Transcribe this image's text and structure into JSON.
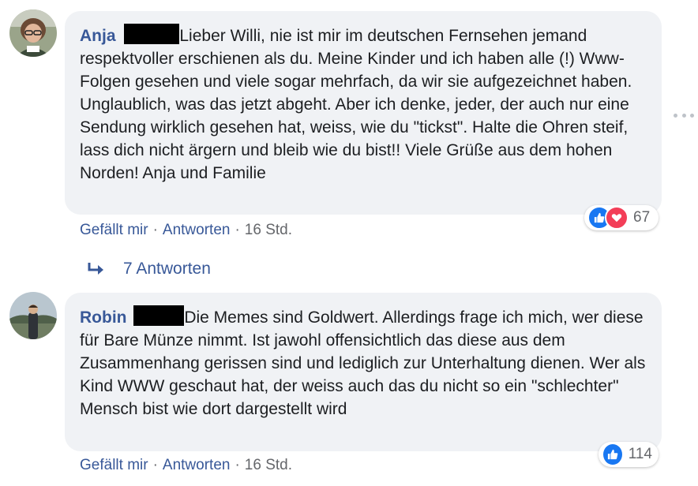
{
  "comments": [
    {
      "author": "Anja",
      "text": "Lieber Willi, nie ist mir im deutschen Fernsehen jemand respektvoller erschienen als du. Meine Kinder und ich haben alle (!) Www-Folgen gesehen und viele sogar mehrfach, da wir sie aufgezeichnet haben. Unglaublich, was das jetzt abgeht. Aber ich denke, jeder, der auch nur eine Sendung wirklich gesehen hat, weiss, wie du \"tickst\". Halte die Ohren steif, lass dich nicht ärgern und bleib wie du bist!! Viele Grüße aus dem hohen Norden! Anja und Familie",
      "like_label": "Gefällt mir",
      "reply_label": "Antworten",
      "time": "16 Std.",
      "reaction_count": "67",
      "reaction_icons": [
        "like-icon",
        "love-icon"
      ],
      "replies_label": "7 Antworten"
    },
    {
      "author": "Robin",
      "text": "Die Memes sind Goldwert. Allerdings frage ich mich, wer diese für Bare Münze nimmt. Ist jawohl offensichtlich das diese aus dem Zusammenhang gerissen sind und lediglich zur Unterhaltung dienen. Wer als Kind WWW geschaut hat, der weiss auch das du nicht so ein \"schlechter\" Mensch bist wie dort dargestellt wird",
      "like_label": "Gefällt mir",
      "reply_label": "Antworten",
      "time": "16 Std.",
      "reaction_count": "114",
      "reaction_icons": [
        "like-icon"
      ]
    }
  ],
  "colors": {
    "link": "#385898",
    "meta": "#65676b",
    "bubble": "#f0f2f5",
    "like": "#1877f2",
    "love": "#f33e58"
  }
}
